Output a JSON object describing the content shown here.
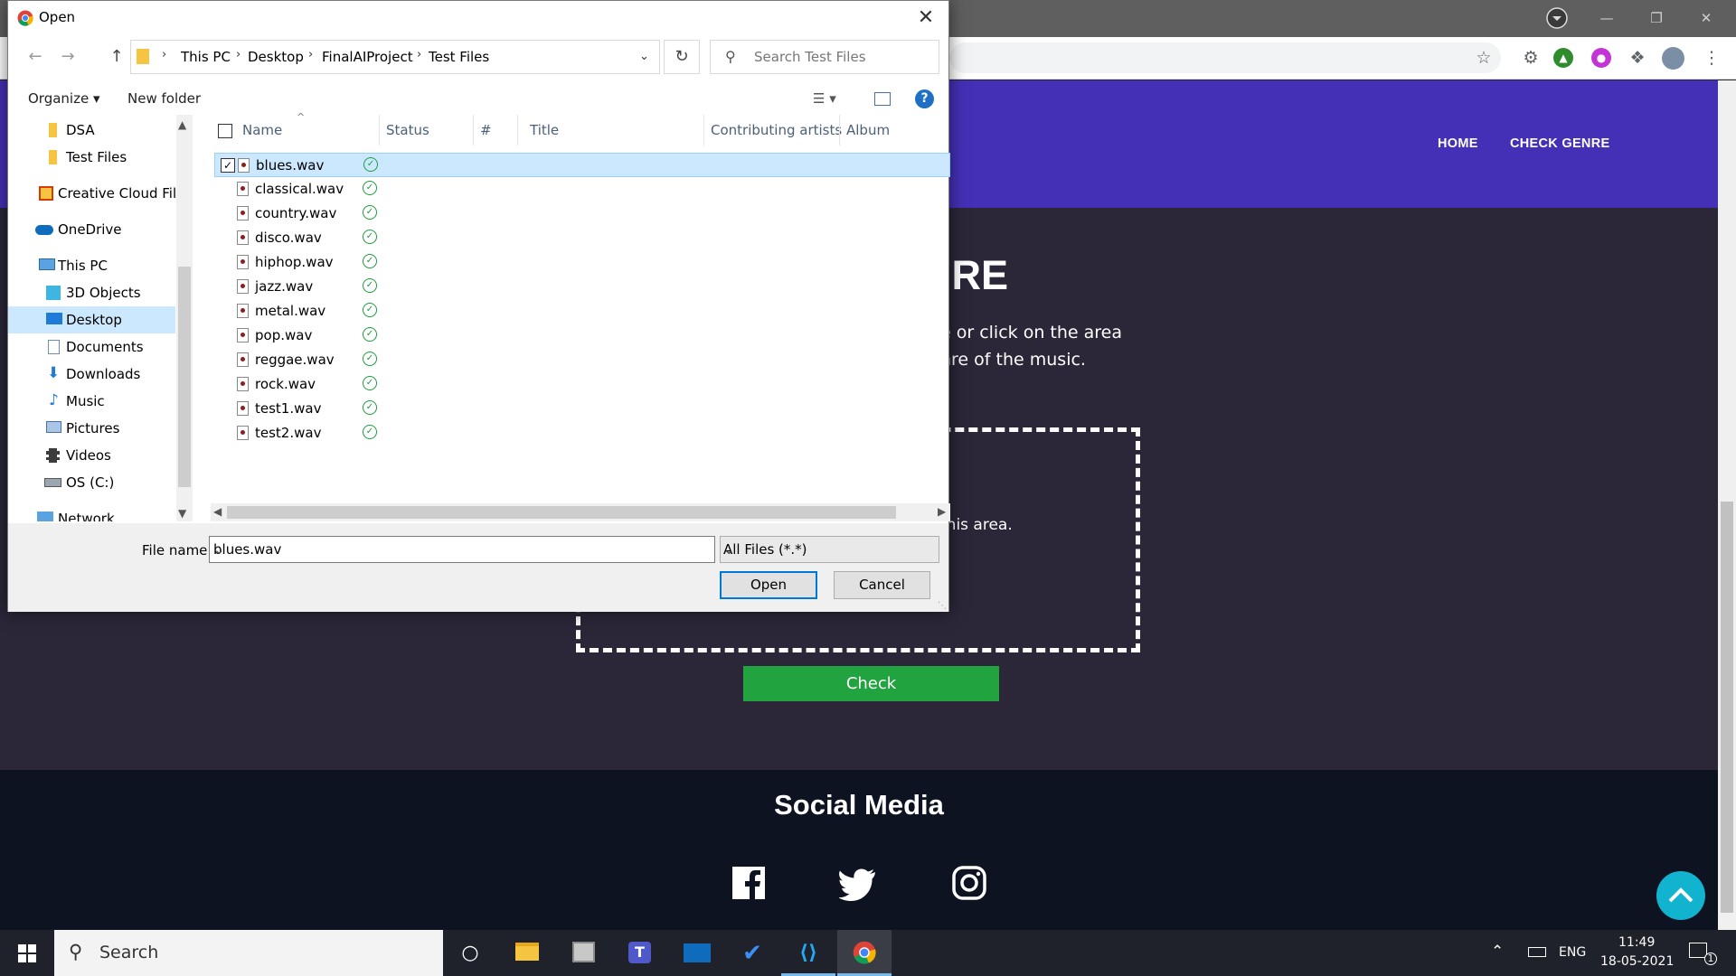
{
  "dialog": {
    "title": "Open",
    "breadcrumbs": [
      "This PC",
      "Desktop",
      "FinalAIProject",
      "Test Files"
    ],
    "search_placeholder": "Search Test Files",
    "commands": {
      "organize": "Organize",
      "new_folder": "New folder"
    },
    "nav_items": [
      {
        "label": "DSA",
        "icon": "folder-icon",
        "selected": false
      },
      {
        "label": "Test Files",
        "icon": "folder-icon",
        "selected": false
      },
      {
        "label": "Creative Cloud Files",
        "icon": "creative-cloud-icon",
        "selected": false
      },
      {
        "label": "OneDrive",
        "icon": "onedrive-icon",
        "selected": false
      },
      {
        "label": "This PC",
        "icon": "computer-icon",
        "selected": false
      },
      {
        "label": "3D Objects",
        "icon": "cube-icon",
        "selected": false
      },
      {
        "label": "Desktop",
        "icon": "desktop-icon",
        "selected": true
      },
      {
        "label": "Documents",
        "icon": "document-icon",
        "selected": false
      },
      {
        "label": "Downloads",
        "icon": "download-icon",
        "selected": false
      },
      {
        "label": "Music",
        "icon": "music-icon",
        "selected": false
      },
      {
        "label": "Pictures",
        "icon": "picture-icon",
        "selected": false
      },
      {
        "label": "Videos",
        "icon": "video-icon",
        "selected": false
      },
      {
        "label": "OS (C:)",
        "icon": "drive-icon",
        "selected": false
      },
      {
        "label": "Network",
        "icon": "network-icon",
        "selected": false
      }
    ],
    "columns": [
      "Name",
      "Status",
      "#",
      "Title",
      "Contributing artists",
      "Album"
    ],
    "files": [
      {
        "name": "blues.wav",
        "selected": true
      },
      {
        "name": "classical.wav",
        "selected": false
      },
      {
        "name": "country.wav",
        "selected": false
      },
      {
        "name": "disco.wav",
        "selected": false
      },
      {
        "name": "hiphop.wav",
        "selected": false
      },
      {
        "name": "jazz.wav",
        "selected": false
      },
      {
        "name": "metal.wav",
        "selected": false
      },
      {
        "name": "pop.wav",
        "selected": false
      },
      {
        "name": "reggae.wav",
        "selected": false
      },
      {
        "name": "rock.wav",
        "selected": false
      },
      {
        "name": "test1.wav",
        "selected": false
      },
      {
        "name": "test2.wav",
        "selected": false
      }
    ],
    "file_name_label": "File name:",
    "file_name_value": "blues.wav",
    "file_type": "All Files (*.*)",
    "open_label": "Open",
    "cancel_label": "Cancel"
  },
  "website": {
    "nav": [
      "HOME",
      "CHECK GENRE"
    ],
    "hero_title_visible": "IRE",
    "hero_line1_visible": "e or click on the area",
    "hero_line2_visible": "nre of the music.",
    "dropzone_text_visible": "this area.",
    "check_button": "Check",
    "footer_title": "Social Media",
    "accent_color": "#4430b6",
    "check_color": "#21a33f"
  },
  "taskbar": {
    "search": "Search",
    "language": "ENG",
    "time": "11:49",
    "date": "18-05-2021",
    "notification_count": "1"
  }
}
